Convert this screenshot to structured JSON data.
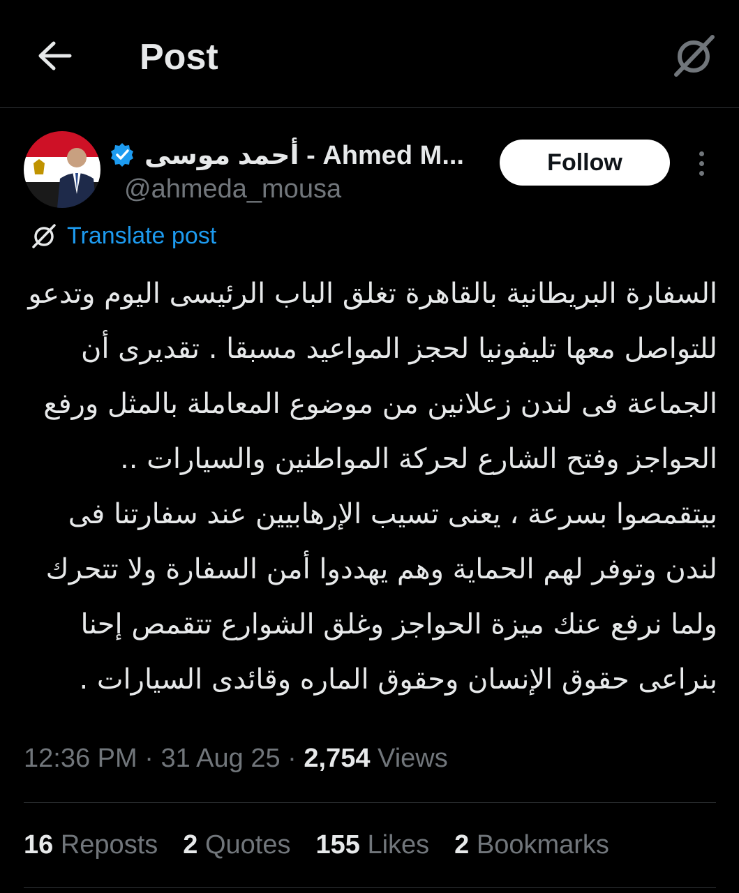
{
  "header": {
    "title": "Post",
    "back_icon": "arrow-left-icon",
    "grok_icon": "slashed-circle-icon"
  },
  "author": {
    "name": "أحمد موسى - Ahmed M...",
    "handle": "@ahmeda_mousa",
    "verified": true,
    "verified_color": "#1d9bf0"
  },
  "actions": {
    "follow_label": "Follow"
  },
  "translate": {
    "label": "Translate post"
  },
  "post": {
    "text": "السفارة البريطانية بالقاهرة تغلق الباب الرئيسى اليوم وتدعو للتواصل معها تليفونيا لحجز المواعيد مسبقا . تقديرى أن الجماعة فى لندن زعلانين من موضوع المعاملة بالمثل ورفع الحواجز وفتح الشارع لحركة المواطنين والسيارات .. بيتقمصوا بسرعة ، يعنى تسيب الإرهابيين عند سفارتنا فى لندن وتوفر لهم الحماية وهم يهددوا أمن السفارة ولا تتحرك ولما نرفع عنك ميزة الحواجز وغلق الشوارع تتقمص إحنا بنراعى حقوق الإنسان وحقوق الماره وقائدى السيارات ."
  },
  "meta": {
    "time": "12:36 PM",
    "date": "31 Aug 25",
    "sep": "·",
    "views_count": "2,754",
    "views_label": "Views"
  },
  "stats": [
    {
      "count": "16",
      "label": "Reposts"
    },
    {
      "count": "2",
      "label": "Quotes"
    },
    {
      "count": "155",
      "label": "Likes"
    },
    {
      "count": "2",
      "label": "Bookmarks"
    }
  ],
  "colors": {
    "background": "#000000",
    "text_primary": "#e7e9ea",
    "text_secondary": "#71767b",
    "accent": "#1d9bf0",
    "divider": "#2f3336"
  }
}
